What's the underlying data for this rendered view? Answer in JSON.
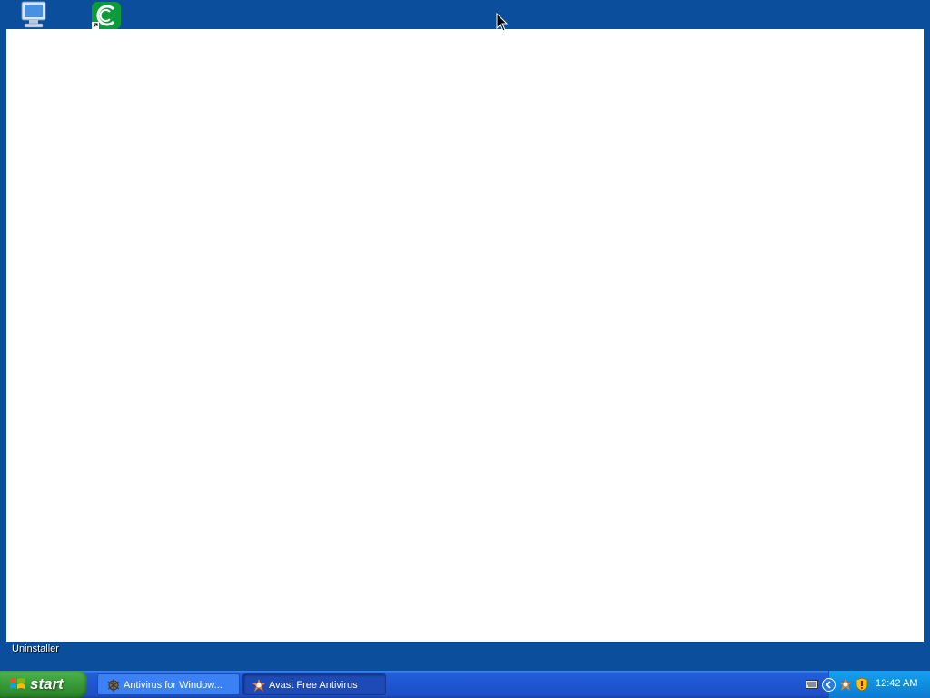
{
  "desktop": {
    "icons": [
      {
        "name": "computer-icon"
      },
      {
        "name": "shortcut-app-icon"
      }
    ],
    "uninstaller_label": "Uninstaller"
  },
  "taskbar": {
    "start_label": "start",
    "tasks": [
      {
        "label": "Antivirus for Window...",
        "icon": "antivirus-icon",
        "active": false
      },
      {
        "label": "Avast Free Antivirus",
        "icon": "avast-icon",
        "active": true
      }
    ],
    "tray": {
      "icons": [
        "keyboard-icon",
        "expand-chevron-icon",
        "avast-tray-icon",
        "security-shield-icon"
      ],
      "clock": "12:42 AM"
    }
  },
  "colors": {
    "desktop_bg": "#0a4e9c",
    "taskbar_blue": "#245edb",
    "start_green": "#3c9f3c",
    "tray_blue": "#0f8ee0",
    "window_bg": "#ffffff"
  }
}
